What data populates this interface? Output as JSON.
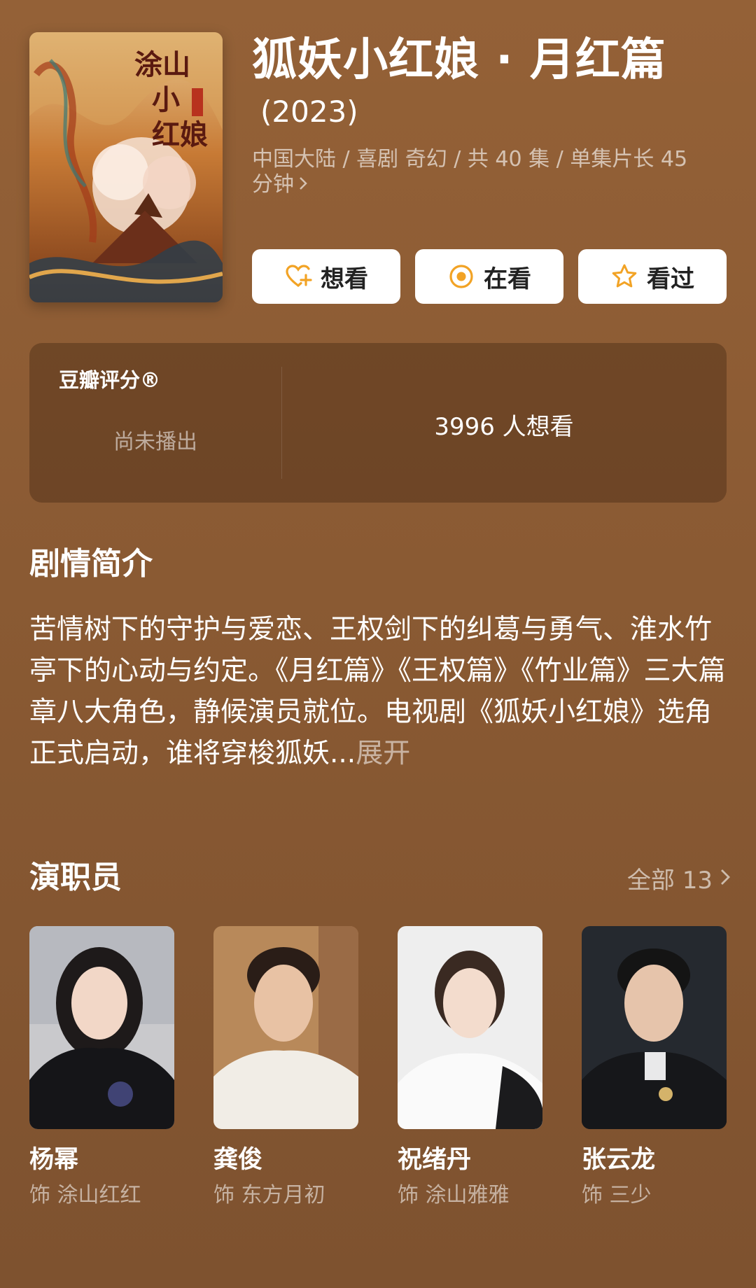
{
  "show": {
    "title": "狐妖小红娘 · 月红篇",
    "year": "(2023)",
    "meta": "中国大陆 / 喜剧 奇幻 / 共 40 集 / 单集片长 45 分钟",
    "poster_title_art": "涂山小红娘"
  },
  "actions": [
    {
      "label": "想看",
      "icon": "heart-plus-icon"
    },
    {
      "label": "在看",
      "icon": "watching-circle-icon"
    },
    {
      "label": "看过",
      "icon": "star-icon"
    }
  ],
  "rating": {
    "title": "豆瓣评分®",
    "status": "尚未播出",
    "want_count": "3996 人想看"
  },
  "synopsis": {
    "heading": "剧情简介",
    "text": "苦情树下的守护与爱恋、王权剑下的纠葛与勇气、淮水竹亭下的心动与约定。《月红篇》《王权篇》《竹业篇》三大篇章八大角色，静候演员就位。电视剧《狐妖小红娘》选角正式启动，谁将穿梭狐妖...",
    "expand_label": "展开"
  },
  "cast": {
    "heading": "演职员",
    "see_all": "全部 13",
    "members": [
      {
        "name": "杨幂",
        "role": "饰 涂山红红"
      },
      {
        "name": "龚俊",
        "role": "饰 东方月初"
      },
      {
        "name": "祝绪丹",
        "role": "饰 涂山雅雅"
      },
      {
        "name": "张云龙",
        "role": "饰 三少"
      }
    ]
  },
  "colors": {
    "background": "#8d5c35",
    "accent_orange": "#f2a325",
    "button_bg": "#ffffff"
  }
}
